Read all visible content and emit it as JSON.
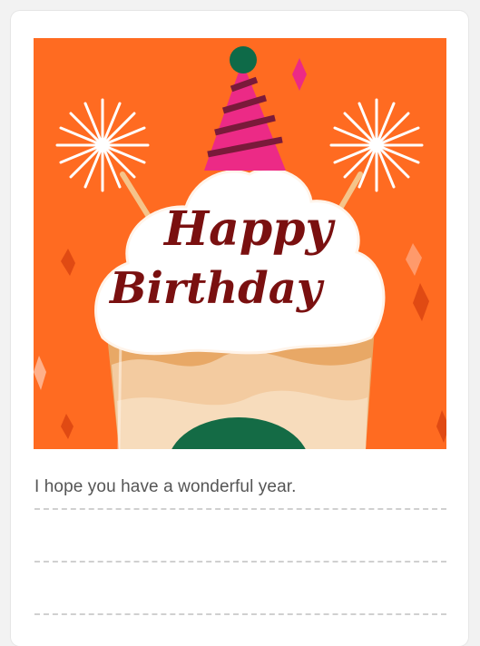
{
  "card": {
    "greeting_line1": "Happy",
    "greeting_line2": "Birthday",
    "message": "I hope you have a wonderful year."
  },
  "colors": {
    "background": "#ff6b21",
    "cream": "#ffffff",
    "script_text": "#7a1010",
    "hat_pink": "#ec2a86",
    "hat_stripe": "#7a1a3a",
    "pompom": "#0e6a48",
    "logo_green": "#146b45",
    "drink": "#e8a866"
  },
  "icons": {
    "art": "birthday-frappuccino-illustration",
    "hat": "party-hat-icon",
    "sparkler": "sparkler-icon",
    "confetti": "confetti-icon"
  }
}
